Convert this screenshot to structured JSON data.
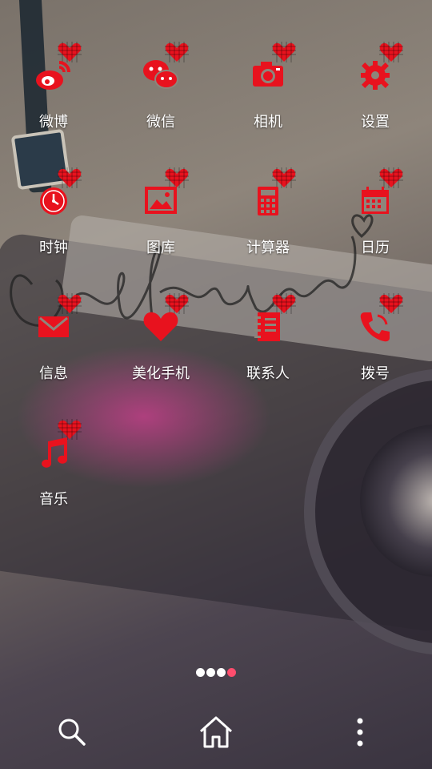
{
  "accent": "#e8121e",
  "apps": [
    {
      "label": "微博",
      "icon": "weibo-icon"
    },
    {
      "label": "微信",
      "icon": "wechat-icon"
    },
    {
      "label": "相机",
      "icon": "camera-icon"
    },
    {
      "label": "设置",
      "icon": "gear-icon"
    },
    {
      "label": "时钟",
      "icon": "clock-icon"
    },
    {
      "label": "图库",
      "icon": "gallery-icon"
    },
    {
      "label": "计算器",
      "icon": "calculator-icon"
    },
    {
      "label": "日历",
      "icon": "calendar-icon"
    },
    {
      "label": "信息",
      "icon": "envelope-icon"
    },
    {
      "label": "美化手机",
      "icon": "heart-icon"
    },
    {
      "label": "联系人",
      "icon": "contacts-book-icon"
    },
    {
      "label": "拨号",
      "icon": "phone-icon"
    },
    {
      "label": "音乐",
      "icon": "music-note-icon"
    }
  ],
  "pages": {
    "count": 4,
    "active": 4
  },
  "dock": [
    {
      "icon": "search-icon"
    },
    {
      "icon": "home-icon"
    },
    {
      "icon": "more-vertical-icon"
    }
  ]
}
